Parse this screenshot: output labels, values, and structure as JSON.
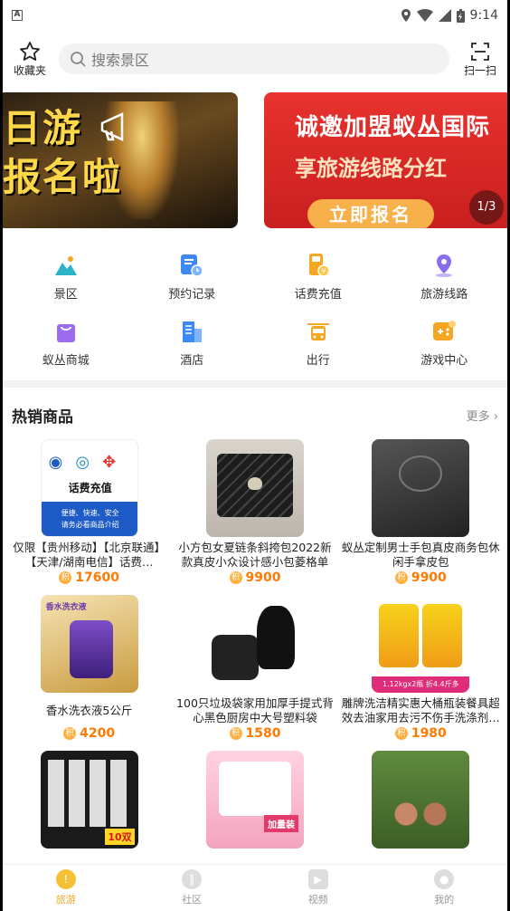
{
  "status_bar": {
    "time": "9:14",
    "app_icon": "A"
  },
  "header": {
    "favorites_label": "收藏夹",
    "search_placeholder": "搜索景区",
    "scan_label": "扫一扫"
  },
  "banners": {
    "slide1_line1": "日游",
    "slide1_line2": "报名啦",
    "slide2_line1": "诚邀加盟蚁丛国际",
    "slide2_line2": "享旅游线路分红",
    "slide2_button": "立即报名",
    "pager": "1/3"
  },
  "menu": [
    {
      "label": "景区",
      "icon": "mountain-icon",
      "color": "#2bb3c8"
    },
    {
      "label": "预约记录",
      "icon": "calendar-record-icon",
      "color": "#3d8af7"
    },
    {
      "label": "话费充值",
      "icon": "phone-recharge-icon",
      "color": "#f5a623"
    },
    {
      "label": "旅游线路",
      "icon": "map-pin-icon",
      "color": "#8a6cf0"
    },
    {
      "label": "蚁丛商城",
      "icon": "shopping-bag-icon",
      "color": "#9b6cf0"
    },
    {
      "label": "酒店",
      "icon": "hotel-building-icon",
      "color": "#3d8af7"
    },
    {
      "label": "出行",
      "icon": "bus-icon",
      "color": "#f5a623"
    },
    {
      "label": "游戏中心",
      "icon": "gamepad-icon",
      "color": "#f5a623"
    }
  ],
  "hot_section": {
    "title": "热销商品",
    "more": "更多 ›"
  },
  "products": [
    {
      "name": "仅限【贵州移动】【北京联通】【天津/湖南电信】话费…",
      "price": "17600",
      "image_text": "话费充值",
      "image_sub": "便捷、快速、安全",
      "image_sub2": "请务必看商品介绍"
    },
    {
      "name": "小方包女夏链条斜挎包2022新款真皮小众设计感小包菱格单肩…",
      "price": "9900"
    },
    {
      "name": "蚁丛定制男士手包真皮商务包休闲手拿皮包",
      "price": "9900"
    },
    {
      "name": "香水洗衣液5公斤",
      "price": "4200",
      "image_text": "香水洗衣液"
    },
    {
      "name": "100只垃圾袋家用加厚手提式背心黑色厨房中大号塑料袋",
      "price": "1580"
    },
    {
      "name": "雕牌洗洁精实惠大桶瓶装餐具超效去油家用去污不伤手洗涤剂…",
      "price": "1980",
      "image_text": "1.12kgx2瓶 折4.4斤多"
    },
    {
      "name": "",
      "price": "",
      "image_text": "10双"
    },
    {
      "name": "",
      "price": "",
      "image_text": "加量装"
    },
    {
      "name": "",
      "price": ""
    }
  ],
  "tabbar": [
    {
      "label": "旅游",
      "active": true
    },
    {
      "label": "社区",
      "active": false
    },
    {
      "label": "视频",
      "active": false
    },
    {
      "label": "我的",
      "active": false
    }
  ],
  "coin_glyph": "积"
}
